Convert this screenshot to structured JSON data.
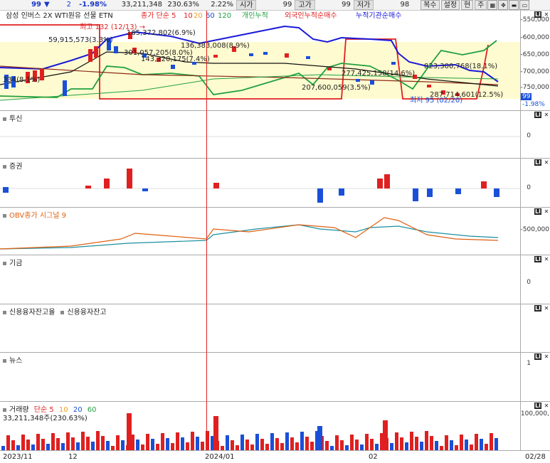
{
  "topbar": {
    "price": "99",
    "arrow": "▼",
    "change": "2",
    "rate": "-1.98%",
    "volume": "33,211,348",
    "volume_rate": "230.63%",
    "open_rate": "2.22%",
    "open_label": "시가",
    "open": "99",
    "high_label": "고가",
    "high": "99",
    "low_label": "저가",
    "low": "98",
    "buttons": [
      "복수",
      "설정",
      "현",
      "주"
    ]
  },
  "main": {
    "legend": {
      "title": "삼성 인버스 2X WTI원유 선물 ETN",
      "ma_label": "종가 단순 5",
      "ma10": "10",
      "ma20": "20",
      "ma60": "60",
      "ma120": "120",
      "indiv": "개인누적",
      "foreign": "외국인누적순매수",
      "inst": "누적기관순매수"
    },
    "annotations": {
      "high": "최고 132 (12/13) →",
      "a1": "165,372,802(6.9%)",
      "a2": "59,915,573(3.3%)",
      "a3": "136,383,008(8.9%)",
      "a4": "301,057,205(8.0%)",
      "a5": "143,320,175(7.4%)",
      "a6": "277,425,158(14.6%)",
      "a7": "823,300,768(18.1%)",
      "a8": "207,600,059(3.5%)",
      "a9": "287,714,601(12.5%)",
      "a10": "334(8.1%)",
      "low": "최저 95 (02/20)"
    },
    "axis_ticks": [
      "-550,000",
      "-600,000",
      "-650,000",
      "-700,000",
      "-750,000"
    ],
    "current_price": "99",
    "current_rate": "-1.98%"
  },
  "panes": [
    {
      "label": "투신",
      "ticks": [
        "0"
      ]
    },
    {
      "label": "증권",
      "ticks": [
        "0"
      ]
    },
    {
      "label": "OBV종가  시그널 9",
      "ticks": [
        "-500,000"
      ]
    },
    {
      "label": "기금",
      "ticks": [
        "0"
      ]
    },
    {
      "label": "신용융자잔고율",
      "label2": "신용융자잔고",
      "ticks": []
    },
    {
      "label": "뉴스",
      "ticks": [
        "1"
      ]
    }
  ],
  "volume": {
    "label": "거래량",
    "ma_label": "단순 5",
    "ma10": "10",
    "ma20": "20",
    "ma60": "60",
    "value": "33,211,348주(230.63%)",
    "tick": "100,000,"
  },
  "xaxis": {
    "labels": [
      "2023/11",
      "12",
      "2024/01",
      "02",
      "02/28"
    ]
  },
  "colors": {
    "up": "#e02020",
    "down": "#1a4fd8",
    "ma5": "#e02020",
    "ma10": "#f0a020",
    "ma20": "#1a4fd8",
    "ma60": "#20a040",
    "ma120": "#8b2a1a",
    "indiv": "#20a040",
    "foreign": "#e02020",
    "inst": "#1a1ad8"
  }
}
